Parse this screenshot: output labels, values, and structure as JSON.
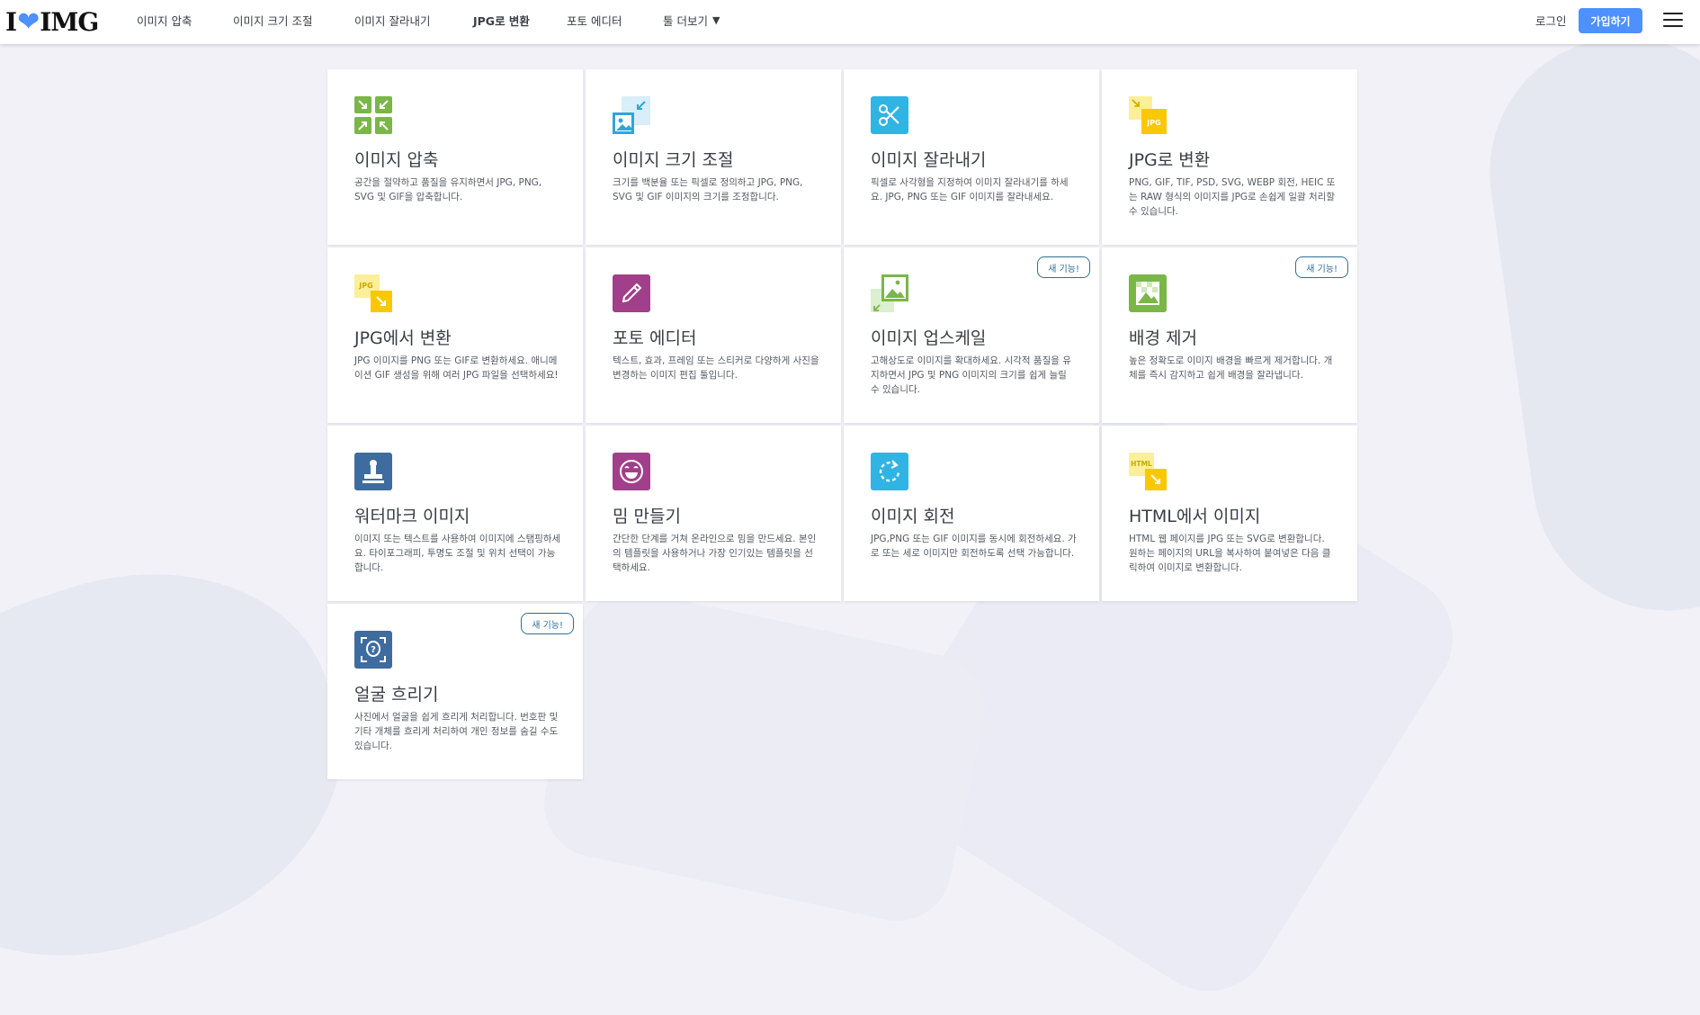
{
  "brand": {
    "logo_left": "I",
    "logo_right": "IMG"
  },
  "nav": {
    "compress": "이미지 압축",
    "resize": "이미지 크기 조절",
    "crop": "이미지 잘라내기",
    "to_jpg": "JPG로 변환",
    "editor": "포토 에디터",
    "more": "툴 더보기",
    "login": "로그인",
    "signup": "가입하기"
  },
  "badge_label": "새 기능!",
  "tools": [
    {
      "title": "이미지 압축",
      "desc": "공간을 절약하고 품질을 유지하면서 JPG, PNG, SVG 및 GIF을 압축합니다."
    },
    {
      "title": "이미지 크기 조절",
      "desc": "크기를 백분율 또는 픽셀로 정의하고 JPG, PNG, SVG 및 GIF 이미지의 크기를 조정합니다."
    },
    {
      "title": "이미지 잘라내기",
      "desc": "픽셀로 사각형을 지정하여 이미지 잘라내기를 하세요. JPG, PNG 또는 GIF 이미지를 잘라내세요."
    },
    {
      "title": "JPG로 변환",
      "desc": "PNG, GIF, TIF, PSD, SVG, WEBP 회전, HEIC 또는 RAW 형식의 이미지를 JPG로 손쉽게 일괄 처리할 수 있습니다."
    },
    {
      "title": "JPG에서 변환",
      "desc": "JPG 이미지를 PNG 또는 GIF로 변환하세요. 애니메이션 GIF 생성을 위해 여러 JPG 파일을 선택하세요!"
    },
    {
      "title": "포토 에디터",
      "desc": "텍스트, 효과, 프레임 또는 스티커로 다양하게 사진을 변경하는 이미지 편집 툴입니다."
    },
    {
      "title": "이미지 업스케일",
      "desc": "고해상도로 이미지를 확대하세요. 시각적 품질을 유지하면서 JPG 및 PNG 이미지의 크기를 쉽게 늘릴 수 있습니다."
    },
    {
      "title": "배경 제거",
      "desc": "높은 정확도로 이미지 배경을 빠르게 제거합니다. 개체를 즉시 감지하고 쉽게 배경을 잘라냅니다."
    },
    {
      "title": "워터마크 이미지",
      "desc": "이미지 또는 텍스트를 사용하여 이미지에 스탬핑하세요. 타이포그래피, 투명도 조절 및 위치 선택이 가능합니다."
    },
    {
      "title": "밈 만들기",
      "desc": "간단한 단계를 거쳐 온라인으로 밈을 만드세요. 본인의 템플릿을 사용하거나 가장 인기있는 템플릿을 선택하세요."
    },
    {
      "title": "이미지 회전",
      "desc": "JPG,PNG 또는 GIF 이미지를 동시에 회전하세요. 가로 또는 세로 이미지만 회전하도록 선택 가능합니다."
    },
    {
      "title": "HTML에서 이미지",
      "desc": "HTML 웹 페이지를 JPG 또는 SVG로 변환합니다. 원하는 페이지의 URL을 복사하여 붙여넣은 다음 클릭하여 이미지로 변환합니다."
    },
    {
      "title": "얼굴 흐리기",
      "desc": "사진에서 얼굴을 쉽게 흐리게 처리합니다. 번호판 및 기타 개체를 흐리게 처리하여 개인 정보를 숨길 수도 있습니다."
    }
  ],
  "colors": {
    "accent": "#4d90fe",
    "badge": "#2f6f97"
  }
}
